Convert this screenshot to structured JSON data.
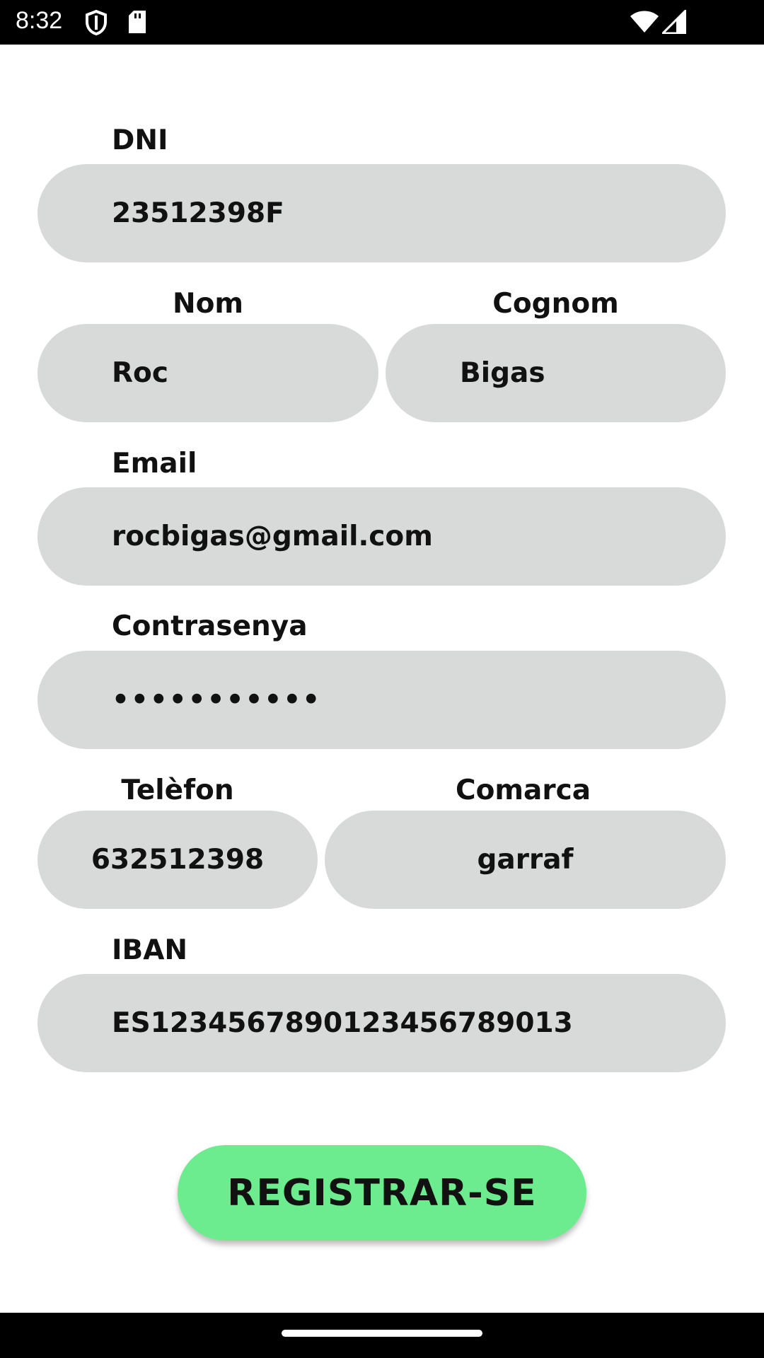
{
  "status_bar": {
    "time": "8:32",
    "icons": [
      "shield-icon",
      "sd-card-icon",
      "wifi-icon",
      "signal-icon"
    ]
  },
  "form": {
    "dni": {
      "label": "DNI",
      "value": "23512398F"
    },
    "nom": {
      "label": "Nom",
      "value": "Roc"
    },
    "cognom": {
      "label": "Cognom",
      "value": "Bigas"
    },
    "email": {
      "label": "Email",
      "value": "rocbigas@gmail.com"
    },
    "contrasenya": {
      "label": "Contrasenya",
      "value": "•••••••••••"
    },
    "telefon": {
      "label": "Telèfon",
      "value": "632512398"
    },
    "comarca": {
      "label": "Comarca",
      "value": "garraf"
    },
    "iban": {
      "label": "IBAN",
      "value": "ES12345678901234567890​13"
    }
  },
  "register_button": {
    "label": "REGISTRAR-SE"
  },
  "colors": {
    "field_background": "#d7dad8",
    "button_background": "#6cec8f",
    "bars": "#000000"
  }
}
